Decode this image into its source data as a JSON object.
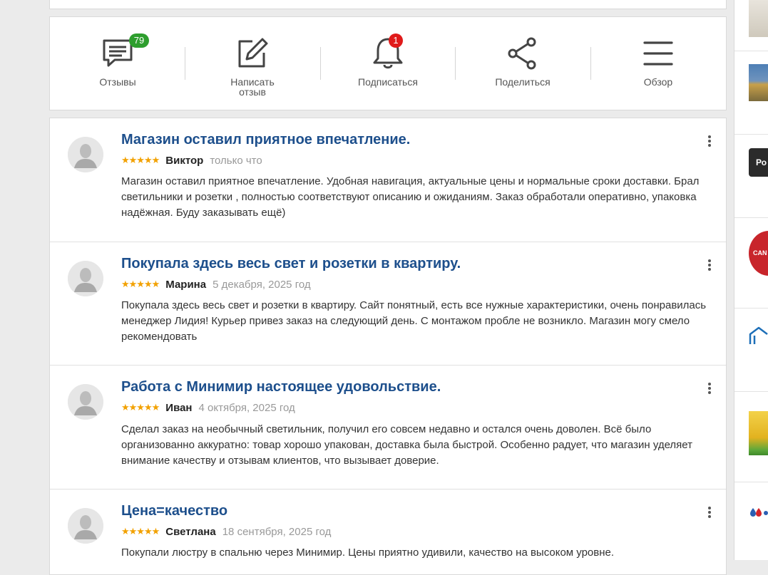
{
  "actions": [
    {
      "label": "Отзывы",
      "icon": "comments-icon",
      "badge": "79"
    },
    {
      "label": "Написать\nотзыв",
      "icon": "edit-icon"
    },
    {
      "label": "Подписаться",
      "icon": "bell-icon",
      "badge": "1"
    },
    {
      "label": "Поделиться",
      "icon": "share-icon"
    },
    {
      "label": "Обзор",
      "icon": "menu-icon"
    }
  ],
  "colors": {
    "title": "#1d4f8c",
    "stars": "#f2a100",
    "badge_green": "#2e9e2e",
    "badge_red": "#e01a1a"
  },
  "reviews": [
    {
      "title": "Магазин оставил приятное впечатление.",
      "stars": "★★★★★",
      "rating": 5,
      "author": "Виктор",
      "date": "только что",
      "text": "Магазин оставил приятное впечатление. Удобная навигация, актуальные цены и нормальные сроки доставки. Брал светильники и розетки , полностью соответствуют описанию и ожиданиям. Заказ обработали оперативно, упаковка надёжная. Буду заказывать ещё)"
    },
    {
      "title": "Покупала здесь весь свет и розетки в квартиру.",
      "stars": "★★★★★",
      "rating": 5,
      "author": "Марина",
      "date": "5 декабря, 2025 год",
      "text": "Покупала здесь весь свет и розетки в квартиру. Сайт понятный, есть все нужные характеристики, очень понравилась менеджер Лидия! Курьер привез заказ на следующий день. С монтажом пробле не возникло. Магазин могу смело рекомендовать"
    },
    {
      "title": "Работа с Минимир настоящее удовольствие.",
      "stars": "★★★★★",
      "rating": 5,
      "author": "Иван",
      "date": "4 октября, 2025 год",
      "text": "Сделал заказ на необычный светильник, получил его совсем недавно и остался очень доволен. Всё было организованно аккуратно: товар хорошо упакован, доставка была быстрой. Особенно радует, что магазин уделяет внимание качеству и отзывам клиентов, что вызывает доверие."
    },
    {
      "title": "Цена=качество",
      "stars": "★★★★★",
      "rating": 5,
      "author": "Светлана",
      "date": "18 сентября, 2025 год",
      "text": "Покупали люстру в спальню через Минимир. Цены приятно удивили, качество на высоком уровне."
    }
  ],
  "sidebar": {
    "thumb_labels": [
      "Ро",
      "CAN"
    ]
  }
}
